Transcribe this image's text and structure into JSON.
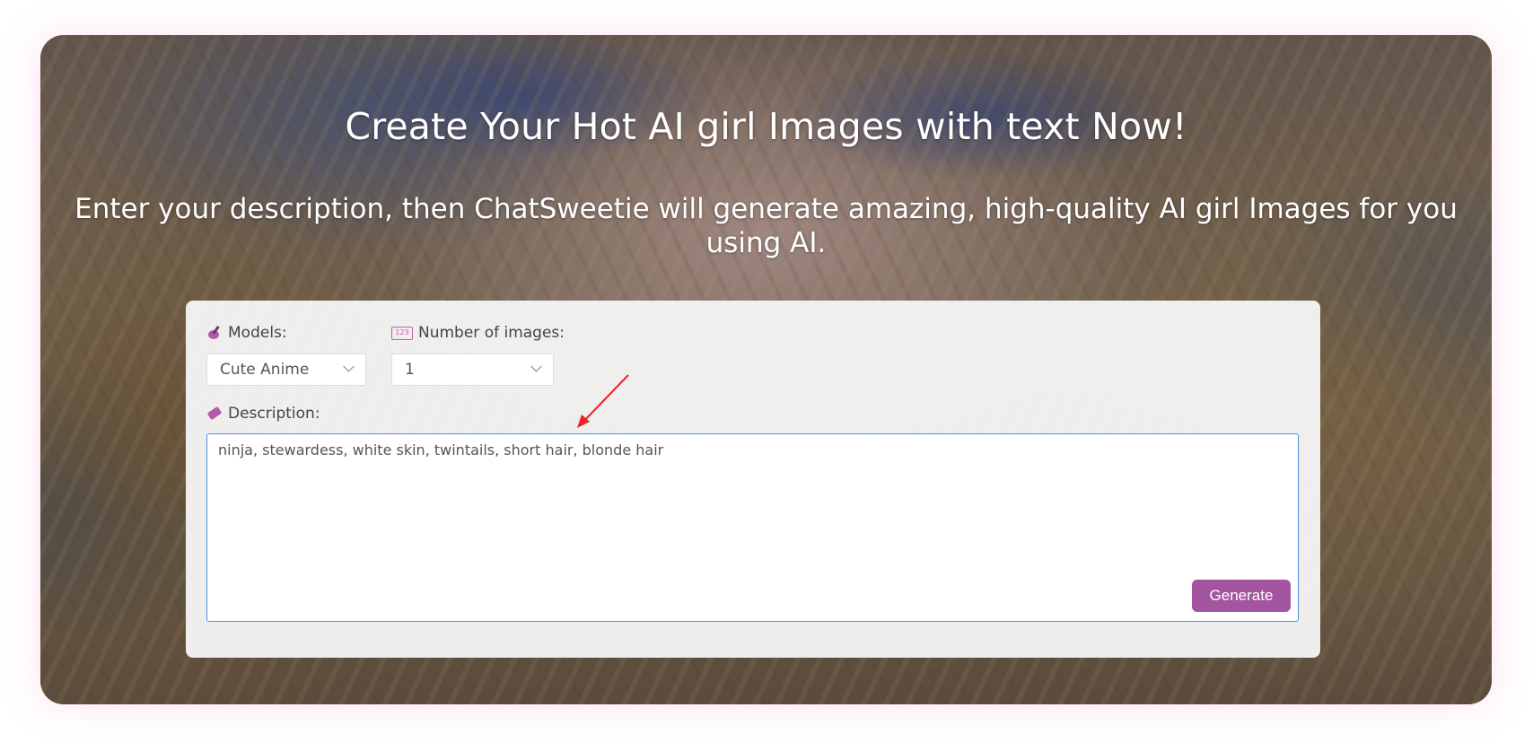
{
  "hero": {
    "title": "Create Your Hot AI girl Images with text Now!",
    "subtitle": "Enter your description, then ChatSweetie will generate amazing, high-quality AI girl Images for you using AI."
  },
  "form": {
    "models": {
      "label": "Models:",
      "icon": "brush-icon",
      "selected": "Cute Anime"
    },
    "count": {
      "label": "Number of images:",
      "icon": "numbers-icon",
      "icon_text": "123",
      "selected": "1"
    },
    "description": {
      "label": "Description:",
      "icon": "eraser-icon",
      "value": "ninja, stewardess, white skin, twintails, short hair, blonde hair"
    },
    "generate_label": "Generate"
  },
  "colors": {
    "accent": "#a3559f",
    "focus_border": "#4a90e2",
    "annotation_arrow": "#e8232a"
  }
}
